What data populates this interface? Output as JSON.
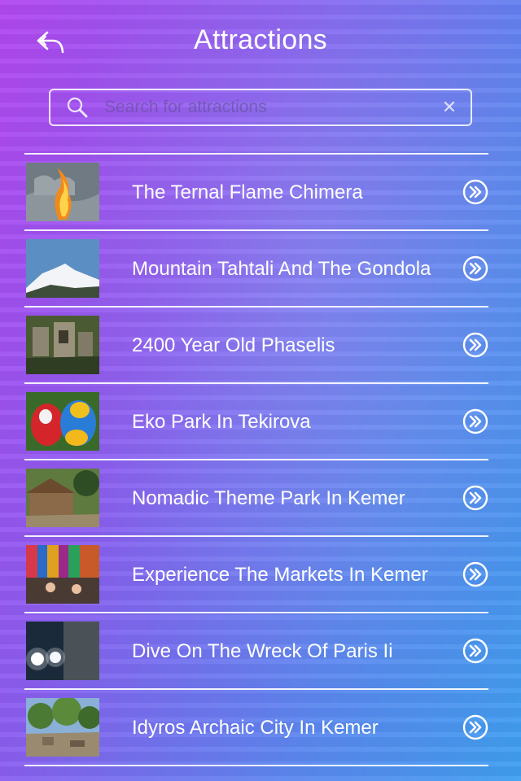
{
  "header": {
    "title": "Attractions",
    "back_icon": "back-arrow-icon"
  },
  "search": {
    "placeholder": "Search for attractions",
    "value": "",
    "search_icon": "search-icon",
    "clear_icon": "close-icon",
    "clear_glyph": "✕"
  },
  "attractions": [
    {
      "label": "The Ternal Flame Chimera",
      "thumb": "flame-on-rocks-photo"
    },
    {
      "label": "Mountain Tahtali And The Gondola",
      "thumb": "snowy-mountain-photo"
    },
    {
      "label": "2400 Year Old Phaselis",
      "thumb": "ancient-ruins-photo"
    },
    {
      "label": "Eko Park In Tekirova",
      "thumb": "parrots-photo"
    },
    {
      "label": "Nomadic Theme Park In Kemer",
      "thumb": "tent-theme-park-photo"
    },
    {
      "label": "Experience The Markets In Kemer",
      "thumb": "market-stalls-photo"
    },
    {
      "label": "Dive On The Wreck Of Paris Ii",
      "thumb": "underwater-wreck-photo"
    },
    {
      "label": "Idyros Archaic City In Kemer",
      "thumb": "archaic-city-trees-photo"
    }
  ],
  "colors": {
    "gradient_start": "#b247f0",
    "gradient_end": "#3f9ff0",
    "foreground": "#ffffff"
  }
}
